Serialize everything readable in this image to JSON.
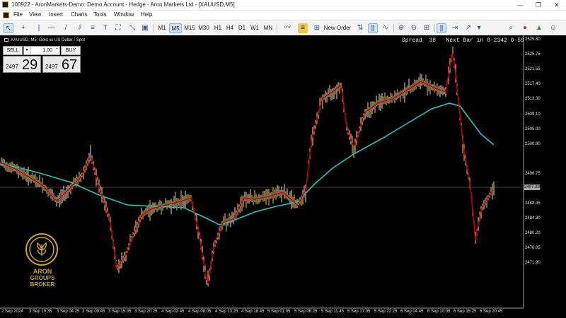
{
  "window": {
    "title": "100922 - AronMarkets-Demo: Demo Account - Hedge - Aron Markets Ltd - [XAUUSD,M5]",
    "controls": [
      "—",
      "❐",
      "✕"
    ]
  },
  "menu": [
    "File",
    "View",
    "Insert",
    "Charts",
    "Tools",
    "Window",
    "Help"
  ],
  "toolbar": {
    "timeframes": [
      "M1",
      "M5",
      "M15",
      "M30",
      "H1",
      "H4",
      "D1",
      "W1",
      "MN"
    ],
    "selected_timeframe": "M5",
    "new_order_label": "New Order"
  },
  "chart": {
    "symbol_title": "XAUUSD, M5:  Gold vs US Dollar / Spot",
    "spread_info": "Spread  38   Next Bar in 0-2342 0-59",
    "current_price_label": "2497.29"
  },
  "trade_panel": {
    "sell_label": "SELL",
    "buy_label": "BUY",
    "lot_value": "1.00",
    "sell_price_prefix": "2497",
    "sell_price_big": "29",
    "buy_price_prefix": "2497",
    "buy_price_big": "67"
  },
  "price_axis": [
    "2529.80",
    "2525.75",
    "2521.55",
    "2517.40",
    "2513.30",
    "2509.10",
    "2505.00",
    "2500.90",
    "2496.75",
    "2492.55",
    "2488.45",
    "2484.30",
    "2480.20",
    "2476.05",
    "2471.90"
  ],
  "time_axis": [
    "2 Sep 2024",
    "3 Sep 19:35",
    "3 Sep 04:25",
    "3 Sep 09:45",
    "3 Sep 15:05",
    "3 Sep 20:25",
    "4 Sep 02:45",
    "4 Sep 08:05",
    "4 Sep 13:25",
    "4 Sep 18:45",
    "5 Sep 01:05",
    "5 Sep 06:25",
    "5 Sep 11:45",
    "5 Sep 17:05",
    "5 Sep 22:25",
    "6 Sep 04:45",
    "6 Sep 10:05",
    "6 Sep 15:25",
    "6 Sep 20:45"
  ],
  "broker_logo": {
    "lines": [
      "ARON",
      "GROUPS",
      "BROKER"
    ]
  },
  "colors": {
    "background": "#000000",
    "candles": "#f5deb3",
    "fast_ma": "#cc0000",
    "slow_ma": "#20c4c4",
    "gold": "#c9a227"
  }
}
